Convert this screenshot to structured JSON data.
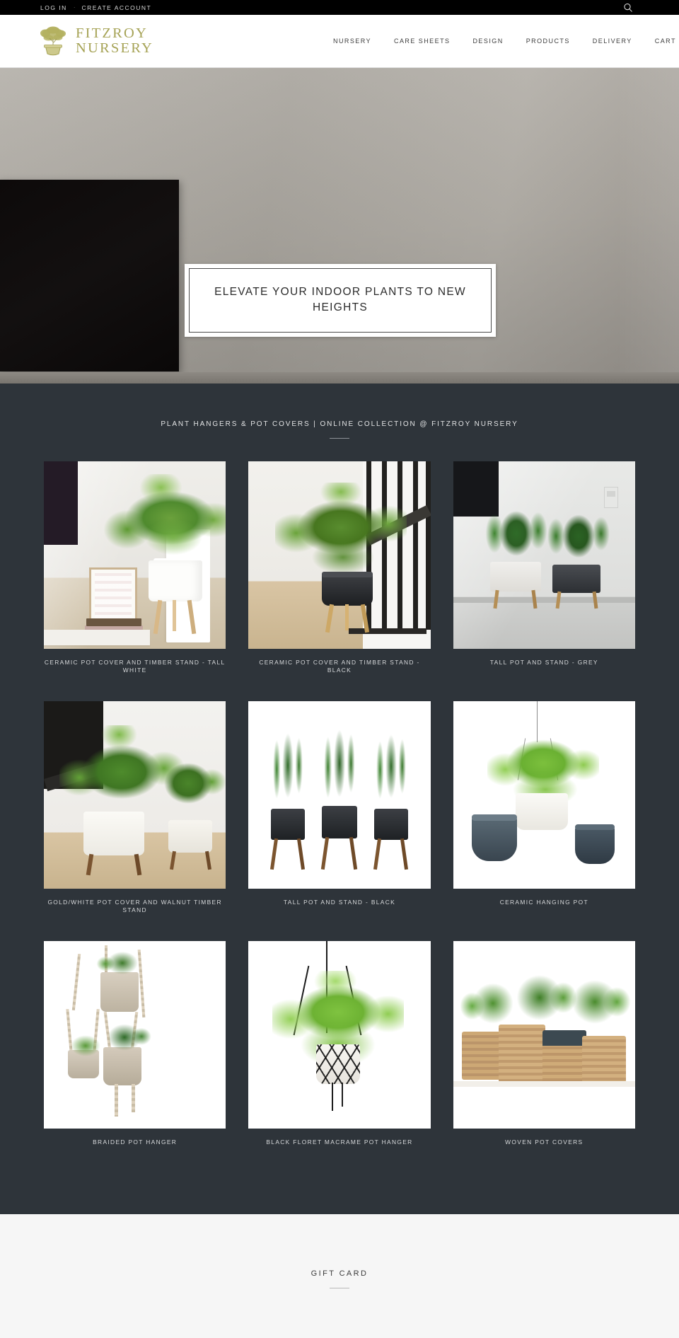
{
  "topbar": {
    "login_label": "LOG IN",
    "separator": "·",
    "create_account_label": "CREATE ACCOUNT",
    "search_icon": "search-icon"
  },
  "header": {
    "logo_line1": "FITZROY",
    "logo_line2": "NURSERY",
    "logo_icon": "bonsai-tree-icon",
    "logo_color": "#a6a356",
    "nav": [
      {
        "label": "NURSERY"
      },
      {
        "label": "CARE SHEETS"
      },
      {
        "label": "DESIGN"
      },
      {
        "label": "PRODUCTS"
      },
      {
        "label": "DELIVERY"
      },
      {
        "label": "CART"
      }
    ]
  },
  "hero": {
    "headline": "ELEVATE YOUR INDOOR PLANTS TO NEW HEIGHTS",
    "background_color": "#a9a59e",
    "panel_color": "#0f0c0c"
  },
  "collection": {
    "heading": "PLANT HANGERS & POT COVERS | ONLINE COLLECTION @ FITZROY NURSERY",
    "background_color": "#2e343a",
    "products": [
      {
        "caption": "CERAMIC POT COVER AND TIMBER STAND - TALL WHITE"
      },
      {
        "caption": "CERAMIC POT COVER AND TIMBER STAND - BLACK"
      },
      {
        "caption": "TALL POT AND STAND - GREY"
      },
      {
        "caption": "GOLD/WHITE POT COVER AND WALNUT TIMBER STAND"
      },
      {
        "caption": "TALL POT AND STAND - BLACK"
      },
      {
        "caption": "CERAMIC HANGING POT"
      },
      {
        "caption": "BRAIDED POT HANGER"
      },
      {
        "caption": "BLACK FLORET MACRAME POT HANGER"
      },
      {
        "caption": "WOVEN POT COVERS"
      }
    ]
  },
  "giftcard": {
    "title": "GIFT CARD",
    "background_color": "#f6f6f6"
  }
}
